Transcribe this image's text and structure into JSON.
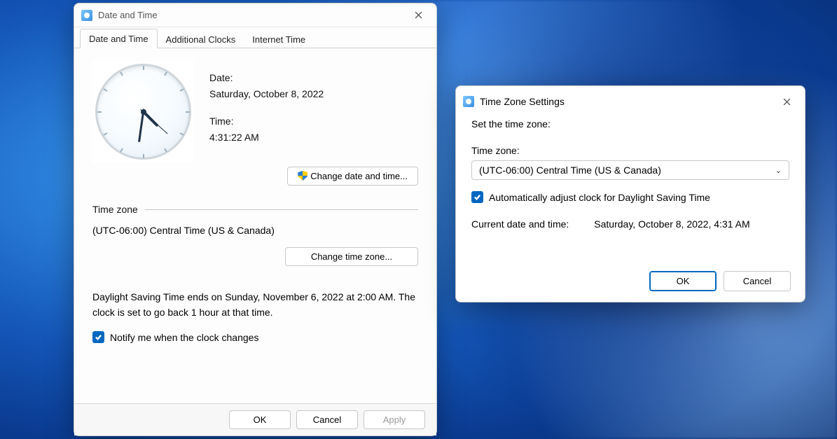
{
  "dt": {
    "title": "Date and Time",
    "tabs": [
      "Date and Time",
      "Additional Clocks",
      "Internet Time"
    ],
    "date_label": "Date:",
    "date_value": "Saturday, October 8, 2022",
    "time_label": "Time:",
    "time_value": "4:31:22 AM",
    "change_dt_btn": "Change date and time...",
    "tz_heading": "Time zone",
    "tz_value": "(UTC-06:00) Central Time (US & Canada)",
    "change_tz_btn": "Change time zone...",
    "dst_text": "Daylight Saving Time ends on Sunday, November 6, 2022 at 2:00 AM. The clock is set to go back 1 hour at that time.",
    "notify_label": "Notify me when the clock changes",
    "ok": "OK",
    "cancel": "Cancel",
    "apply": "Apply"
  },
  "tz": {
    "title": "Time Zone Settings",
    "heading": "Set the time zone:",
    "label": "Time zone:",
    "selected": "(UTC-06:00) Central Time (US & Canada)",
    "auto_dst": "Automatically adjust clock for Daylight Saving Time",
    "current_lbl": "Current date and time:",
    "current_val": "Saturday, October 8, 2022, 4:31 AM",
    "ok": "OK",
    "cancel": "Cancel"
  }
}
